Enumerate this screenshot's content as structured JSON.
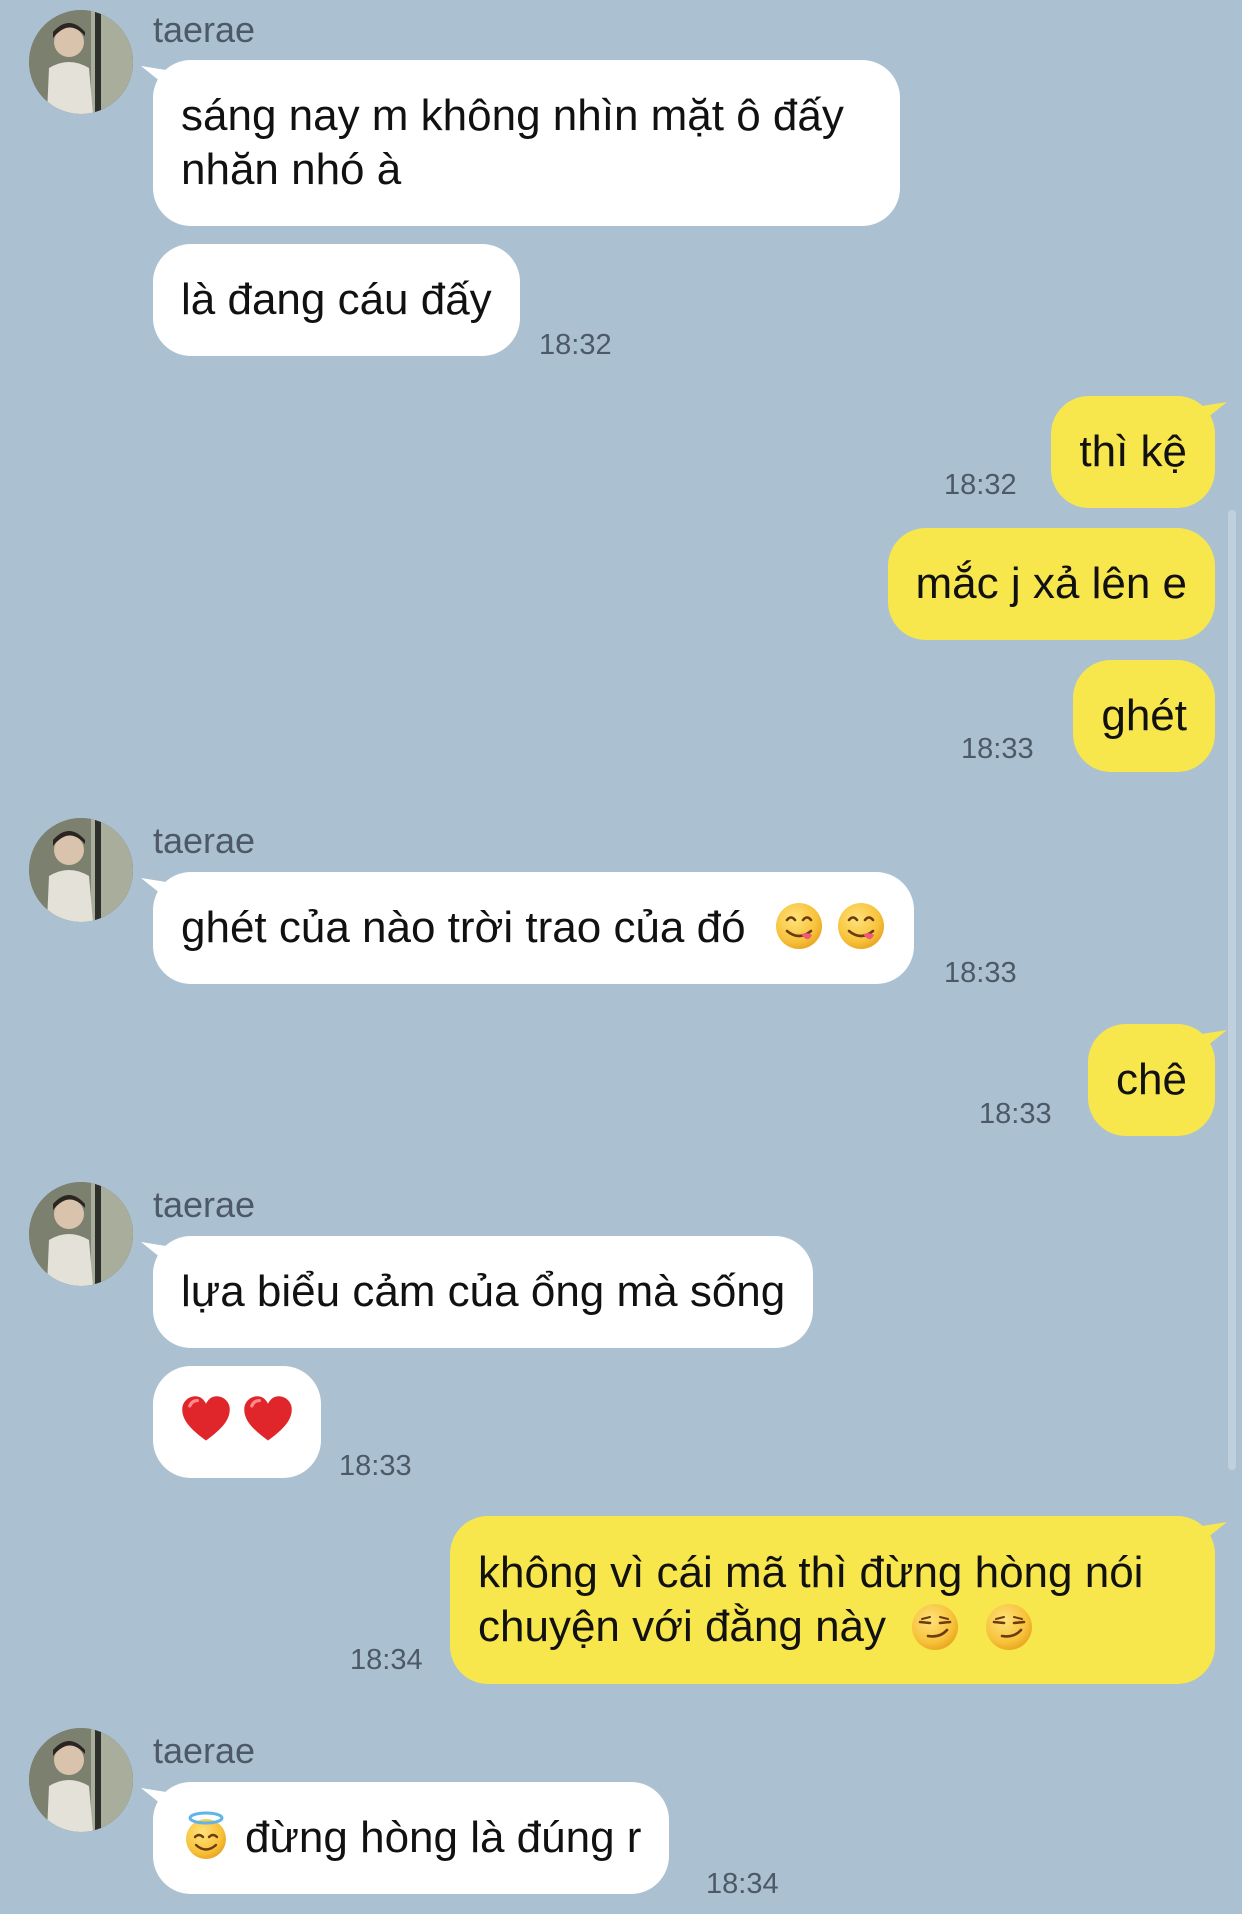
{
  "contact": {
    "name": "taerae"
  },
  "messages": {
    "m1": "sáng nay m không nhìn mặt ô đấy nhăn nhó à",
    "m2": "là đang cáu đấy",
    "m2_time": "18:32",
    "m3": "thì kệ",
    "m3_time": "18:32",
    "m4": "mắc j xả lên e",
    "m5": "ghét",
    "m5_time": "18:33",
    "m6": "ghét của nào trời trao của đó",
    "m6_time": "18:33",
    "m7": "chê",
    "m7_time": "18:33",
    "m8": "lựa biểu cảm của ổng mà sống",
    "m9_time": "18:33",
    "m10": "không vì cái mã thì đừng hòng nói chuyện với đằng này",
    "m10_time": "18:34",
    "m11": "đừng hòng là đúng r",
    "m11_time": "18:34"
  },
  "icons": {
    "yum": "face-savoring-food-icon",
    "heart": "red-heart-icon",
    "smirk": "smirking-face-icon",
    "halo": "smiling-face-with-halo-icon"
  },
  "colors": {
    "background": "#abc1d1",
    "incoming_bubble": "#ffffff",
    "outgoing_bubble": "#f8e64d",
    "meta_text": "#4d5966"
  }
}
